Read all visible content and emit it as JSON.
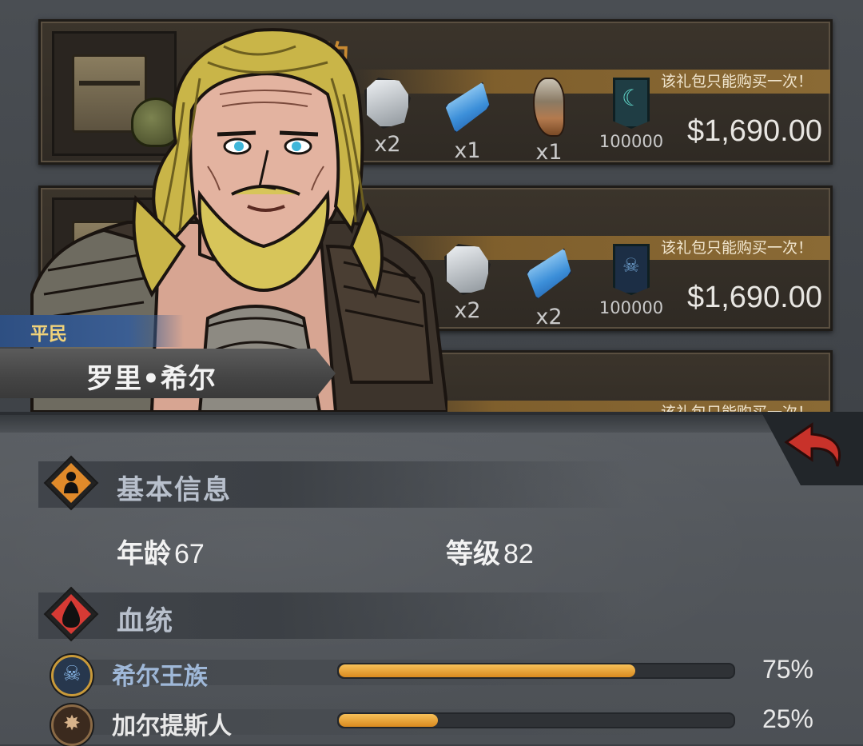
{
  "shop": {
    "packs": [
      {
        "title": "约",
        "banner": "该礼包只能购买一次！",
        "items": [
          {
            "icon": "stone-icon",
            "qty": "x2"
          },
          {
            "icon": "crystal-icon",
            "qty": "x1"
          },
          {
            "icon": "horn-icon",
            "qty": "x1"
          },
          {
            "icon": "banner-icon",
            "qty": "100000"
          }
        ],
        "price": "$1,690.00"
      },
      {
        "title": "",
        "banner": "该礼包只能购买一次！",
        "items": [
          {
            "icon": "stone-icon",
            "qty": "x2"
          },
          {
            "icon": "crystal-icon",
            "qty": "x2"
          },
          {
            "icon": "skull-banner-icon",
            "qty": "100000"
          }
        ],
        "price": "$1,690.00"
      },
      {
        "title": "",
        "banner": "该礼包只能购买一次！",
        "items": [],
        "price": ""
      }
    ]
  },
  "character": {
    "rank": "平民",
    "name": "罗里•希尔"
  },
  "basic_info": {
    "title": "基本信息",
    "age_label": "年龄",
    "age": "67",
    "level_label": "等级",
    "level": "82"
  },
  "bloodline": {
    "title": "血统",
    "entries": [
      {
        "name": "希尔王族",
        "percent": 75,
        "percent_label": "75%",
        "icon": "royal-crest-icon"
      },
      {
        "name": "加尔提斯人",
        "percent": 25,
        "percent_label": "25%",
        "icon": "beast-crest-icon"
      }
    ]
  },
  "colors": {
    "accent_orange": "#d98a1f",
    "royal_blue_text": "#9fb8d8",
    "rank_tag_blue": "#3b5e93",
    "back_arrow_red": "#c8322a"
  }
}
